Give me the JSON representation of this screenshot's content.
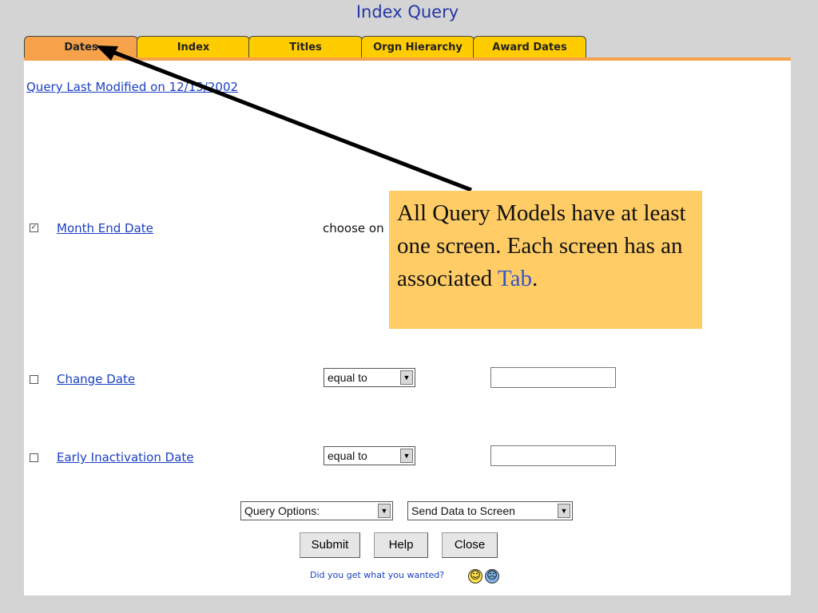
{
  "window": {
    "title": "Index Query"
  },
  "tabs": [
    {
      "label": "Dates",
      "active": true
    },
    {
      "label": "Index",
      "active": false
    },
    {
      "label": "Titles",
      "active": false
    },
    {
      "label": "Orgn Hierarchy",
      "active": false
    },
    {
      "label": "Award Dates",
      "active": false
    }
  ],
  "main": {
    "last_modified_link": "Query Last Modified on 12/15/2002",
    "rows": [
      {
        "label": "Month End Date",
        "checked": true,
        "choose_text": "choose on"
      },
      {
        "label": "Change Date",
        "checked": false,
        "operator": "equal to",
        "value": ""
      },
      {
        "label": "Early Inactivation Date",
        "checked": false,
        "operator": "equal to",
        "value": ""
      }
    ],
    "query_options": "Query Options:",
    "send_data": "Send Data to Screen",
    "buttons": {
      "submit": "Submit",
      "help": "Help",
      "close": "Close"
    },
    "feedback_text": "Did you get what you wanted?"
  },
  "callout": {
    "text_before": "All Query Models have at least one screen. Each screen has an associated ",
    "highlight": "Tab",
    "text_after": "."
  },
  "icons": {
    "dropdown": "dropdown-arrow-icon",
    "happy": "smiley-face-icon",
    "sad": "sad-face-icon",
    "checkmark": "checkmark-icon"
  },
  "colors": {
    "background": "#d4d4d4",
    "tab_active": "#f5a24a",
    "tab_inactive": "#ffcc00",
    "link": "#1a3fc2",
    "callout_bg": "#ffcc66"
  }
}
